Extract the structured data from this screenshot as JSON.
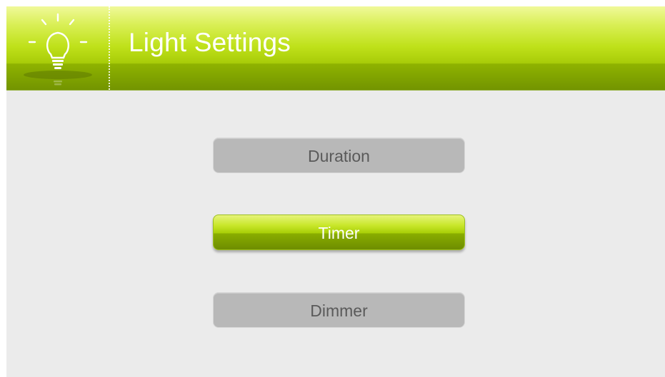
{
  "header": {
    "title": "Light Settings",
    "icon": "light-bulb-icon"
  },
  "menu": {
    "items": [
      {
        "label": "Duration",
        "state": "inactive"
      },
      {
        "label": "Timer",
        "state": "active"
      },
      {
        "label": "Dimmer",
        "state": "inactive"
      }
    ]
  },
  "colors": {
    "accent": "#a9cf07",
    "header_top": "#f0f99a",
    "header_bottom": "#739400",
    "inactive_button": "#b8b8b8",
    "background": "#ebebeb"
  }
}
